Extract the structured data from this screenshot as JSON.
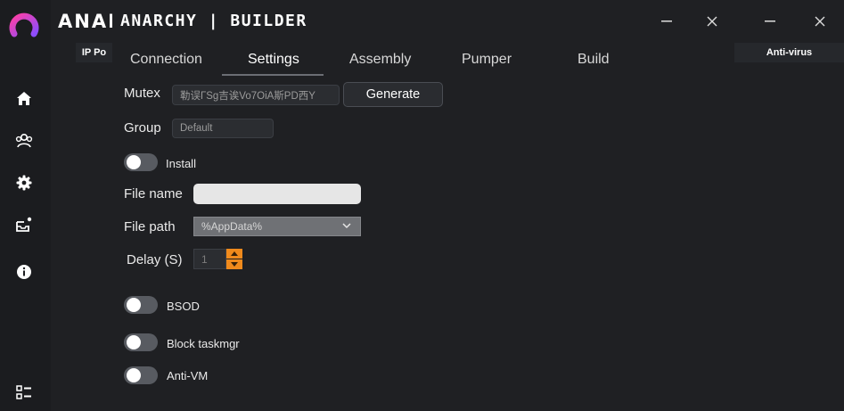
{
  "background_window": {
    "title": "ANARCHY",
    "header_left": "IP Po",
    "header_right": "Anti-virus"
  },
  "builder": {
    "title": "ANARCHY | BUILDER",
    "tabs": [
      {
        "label": "Connection"
      },
      {
        "label": "Settings"
      },
      {
        "label": "Assembly"
      },
      {
        "label": "Pumper"
      },
      {
        "label": "Build"
      }
    ],
    "active_tab": "Settings",
    "mutex": {
      "label": "Mutex",
      "value": "勒误ГSg吉诶Vo7OiA斯PD西Y",
      "generate_label": "Generate"
    },
    "group": {
      "label": "Group",
      "placeholder": "Default"
    },
    "install": {
      "label": "Install",
      "on": false
    },
    "file_name": {
      "label": "File name",
      "value": ""
    },
    "file_path": {
      "label": "File path",
      "selected": "%AppData%"
    },
    "delay": {
      "label": "Delay (S)",
      "value": "1"
    },
    "bsod": {
      "label": "BSOD",
      "on": false
    },
    "block_taskmgr": {
      "label": "Block taskmgr",
      "on": false
    },
    "anti_vm": {
      "label": "Anti-VM",
      "on": false
    }
  },
  "sidebar": {
    "icons": [
      "logo-icon",
      "home-icon",
      "users-icon",
      "gear-icon",
      "builder-icon",
      "info-icon",
      "list-icon"
    ]
  },
  "colors": {
    "accent": "#f08a1c",
    "logo_gradient_start": "#ff3fa4",
    "logo_gradient_end": "#8a4dff",
    "background": "#1f2023"
  }
}
